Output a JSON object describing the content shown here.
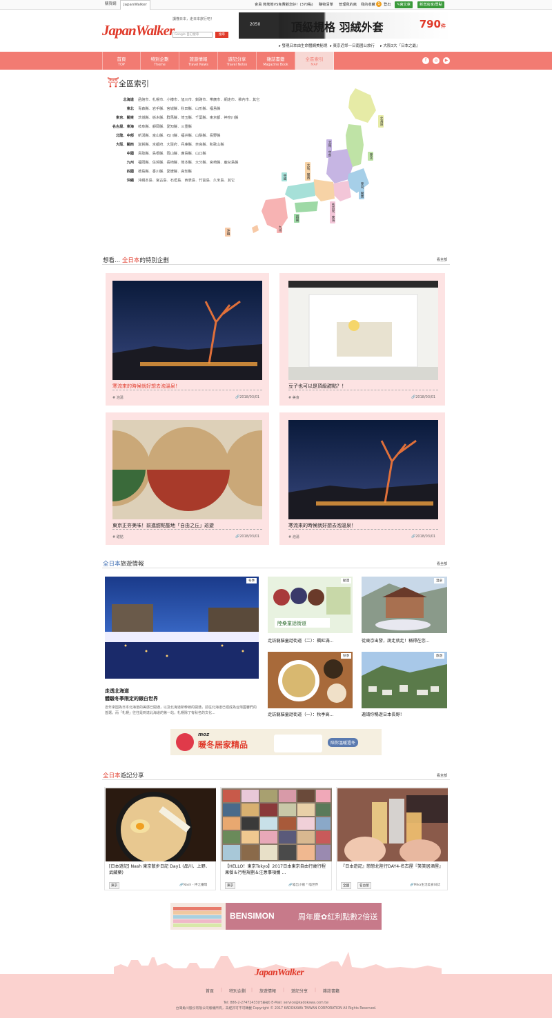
{
  "topbar": {
    "tabs": [
      "購買網",
      "JapanWalker"
    ],
    "member_links": [
      "會員 熊熊熊VS免費觀您好！(370點)",
      "購物清單",
      "管理我的窩",
      "我的收藏",
      "登出"
    ],
    "fav_count": "1",
    "btn_write": "寫文章",
    "btn_new_shop": "新增店家/景點"
  },
  "header": {
    "logo": "JapanWalker",
    "slogan": "讀懂日本，走日本旅行吧！",
    "search_placeholder": "Google 自訂搜尋",
    "search_button": "搜尋",
    "ad_text": "頂級規格 羽絨外套",
    "ad_price": "790",
    "ad_price_unit": "件",
    "ad_year": "2050",
    "news": [
      "發現日本由生命體網美秘境",
      "東京近郊一日南國公旅行",
      "大阪3大『日本之最』"
    ]
  },
  "nav": [
    {
      "zh": "首頁",
      "en": "TOP"
    },
    {
      "zh": "特別企劃",
      "en": "Theme"
    },
    {
      "zh": "旅遊情報",
      "en": "Travel News"
    },
    {
      "zh": "遊記分享",
      "en": "Travel Notes"
    },
    {
      "zh": "雜誌書籍",
      "en": "Magazine Book"
    },
    {
      "zh": "全區索引",
      "en": "MAP"
    }
  ],
  "index": {
    "title": "全區索引",
    "regions": [
      {
        "name": "北海道",
        "list": "函館市．札幌市．小樽市．旭川市．釧路市．帯廣市．網走市．稚內市．其它"
      },
      {
        "name": "東北",
        "list": "青森縣．岩手縣．宮城縣．秋田縣．山形縣．福島縣"
      },
      {
        "name": "東京．關東",
        "list": "茨城縣．栃木縣．群馬縣．埼玉縣．千葉縣．東京都．神奈川縣"
      },
      {
        "name": "名古屋．東海",
        "list": "岐阜縣．靜岡縣．愛知縣．三重縣"
      },
      {
        "name": "北陸．中部",
        "list": "新潟縣．富山縣．石川縣．福井縣．山梨縣．長野縣"
      },
      {
        "name": "大阪．關西",
        "list": "滋賀縣．京都府．大阪府．兵庫縣．奈良縣．和歌山縣"
      },
      {
        "name": "中國",
        "list": "鳥取縣．島根縣．岡山縣．廣島縣．山口縣"
      },
      {
        "name": "九州",
        "list": "福岡縣．佐賀縣．長崎縣．熊本縣．大分縣．宮崎縣．鹿兒島縣"
      },
      {
        "name": "四國",
        "list": "德島縣．香川縣．愛媛縣．高知縣"
      },
      {
        "name": "沖繩",
        "list": "沖繩本島．宮古島．石垣島．西表島．竹富島．久米島．其它"
      }
    ],
    "map_labels": [
      "北海道",
      "東北",
      "北陸．中部",
      "大阪．關西",
      "中國",
      "東京．關東",
      "名古屋．東海",
      "四國",
      "九州",
      "沖繩"
    ]
  },
  "special": {
    "title_prefix": "想看...",
    "title_highlight": "全日本",
    "title_suffix": "的特別企劃",
    "see_all": "看全部",
    "cards": [
      {
        "caption": "寒流來的時候就好想去泡溫泉！",
        "tag": "# 泡湯",
        "date": "2018/03/01"
      },
      {
        "caption": "豆子也可以是頂級甜點？！",
        "tag": "# 美食",
        "date": "2018/03/01"
      },
      {
        "caption": "東京正夯美味！前進甜點聖地「自由之丘」巡遊",
        "tag": "# 甜點",
        "date": "2018/03/01"
      },
      {
        "caption": "寒流來的時候就好想去泡溫泉！",
        "tag": "# 泡湯",
        "date": "2018/03/01"
      }
    ]
  },
  "travel": {
    "title_highlight": "全日本",
    "title_suffix": "旅遊情報",
    "see_all": "看全部",
    "main": {
      "badge": "冬季",
      "title1": "走透北海道",
      "title2": "體驗冬季限定的銀白世界",
      "desc": "近年來因為日本北海道的美感已開通，以及北海道新幹線的開通，前往北海道已經成為台灣國審們的首選。而「札幌」往往是到達北海道的第一站，札幌除了有秋名的文化..."
    },
    "items": [
      {
        "badge": "動漫",
        "caption": "走訪龍貓童話街道（二）：楓紅滿..."
      },
      {
        "badge": "溫泉",
        "caption": "從東京出發，說走就走！稱得在您..."
      },
      {
        "badge": "秋季",
        "caption": "走訪龍貓童話街道（一）：秋季高..."
      },
      {
        "badge": "旅遊",
        "caption": "邀請你暢遊日本長野！"
      }
    ],
    "ad": {
      "brand": "moz",
      "text": "暖冬居家精品",
      "sub": "陪你溫暖過冬"
    }
  },
  "notes": {
    "title_highlight": "全日本",
    "title_suffix": "遊記分享",
    "see_all": "看全部",
    "cards": [
      {
        "caption": "[日本遊記] Nash 東京散步日記 Day1 (品川、上野、武藏藥)",
        "tags": [
          "東京"
        ],
        "author": "Nash - 拌之優瑞"
      },
      {
        "caption": "【HELLO！東京Tokyo】2017日本東京自由行歲行程果餐＆行程規劃＆注意事項攜 ...",
        "tags": [
          "東京"
        ],
        "author": "喵出小窩 * 喵世界"
      },
      {
        "caption": "『日本遊記』戀戀北陸行DAY4-名古屋『笑笑居酒屋』",
        "tags": [
          "全國",
          "名古屋"
        ],
        "author": "Mika生活美食日誌"
      }
    ],
    "ad": {
      "brand": "BENSIMON",
      "text": "周年慶✿紅利點數2倍送"
    }
  },
  "footer": {
    "logo": "JapanWalker",
    "links": [
      "首頁",
      "特別企劃",
      "旅遊情報",
      "遊記分享",
      "雜誌書籍"
    ],
    "contact": "Tel: 886-2-27472433(代表號)    E-Mail: service@kadokawa.com.tw",
    "copyright": "台灣角川股份有限公司版權所有，未經許可不可轉載  Copyright © 2017 KADOKAWA TAIWAN CORPORATION All Rights Reserved."
  },
  "colors": {
    "brand": "#e03a2a",
    "nav": "#f27b72",
    "card": "#fde3e3",
    "footer": "#fbd2cf"
  }
}
